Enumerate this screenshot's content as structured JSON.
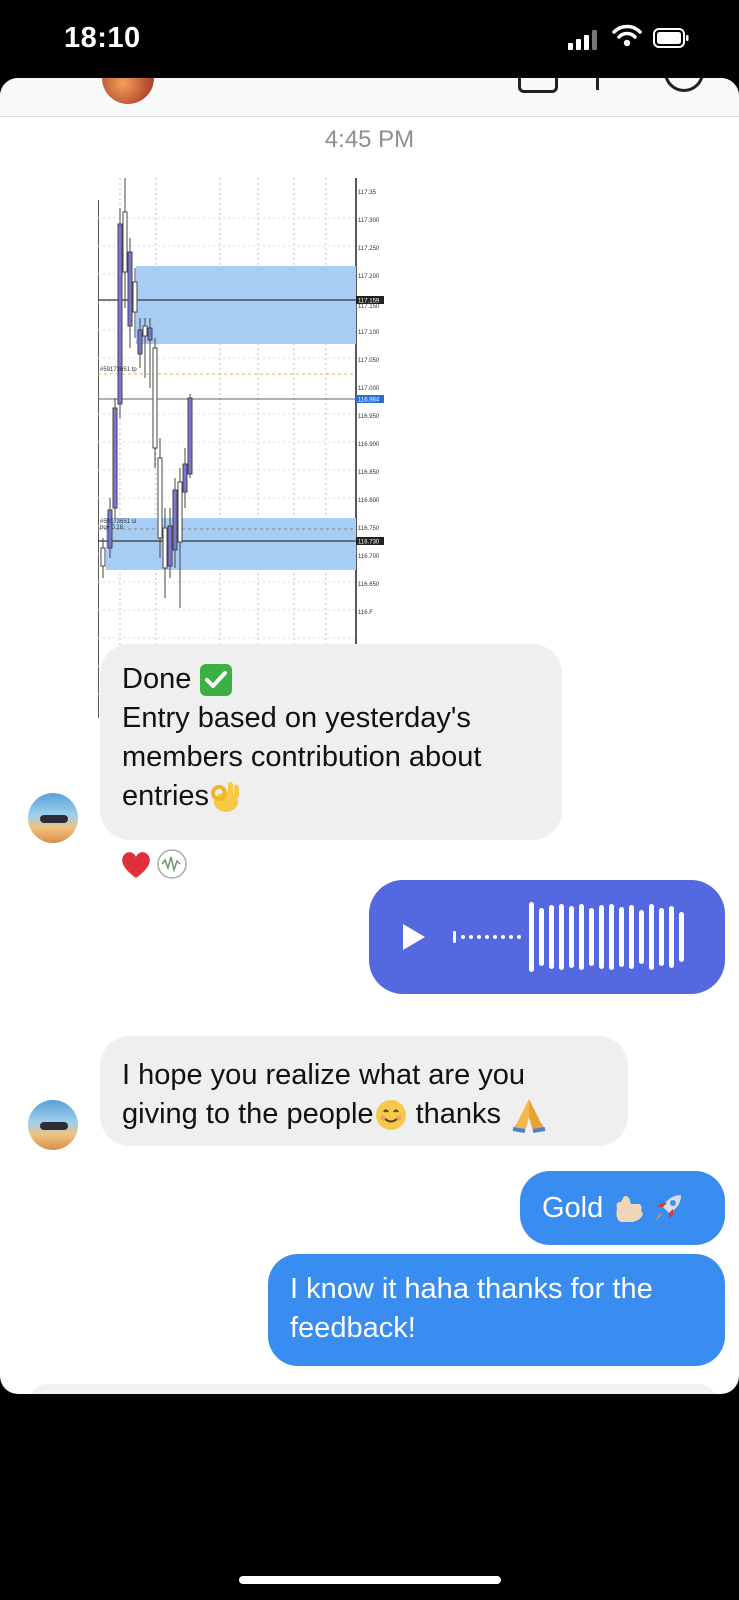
{
  "status_bar": {
    "time": "18:10"
  },
  "thread": {
    "timestamp": "4:45 PM",
    "chart_image": {
      "price_labels": [
        "117.35",
        "117.300",
        "117.250",
        "117.200",
        "117.150",
        "117.100",
        "117.050",
        "117.000",
        "116.950",
        "116.900",
        "116.850",
        "116.800",
        "116.750",
        "116.700",
        "116.650",
        "116.F"
      ],
      "highlight_labels": [
        "117.159",
        "116.964",
        "116.730"
      ],
      "order_labels": [
        "#59173651 tp",
        "#59173651 sl",
        "buy 0.18"
      ]
    },
    "messages": [
      {
        "from": "them",
        "lines": [
          "Done",
          "Entry based on yesterday's",
          "members contribution about",
          "entries"
        ]
      },
      {
        "from": "me",
        "type": "voice"
      },
      {
        "from": "them",
        "lines": [
          "I hope you realize what are you",
          "giving to the people",
          " thanks "
        ]
      },
      {
        "from": "me",
        "text": "Gold "
      },
      {
        "from": "me",
        "lines": [
          "I know it haha thanks for the",
          "feedback!"
        ]
      }
    ]
  },
  "colors": {
    "incoming_bubble": "#efefef",
    "outgoing_bubble": "#3a8df0",
    "voice_bubble": "#5468df"
  }
}
